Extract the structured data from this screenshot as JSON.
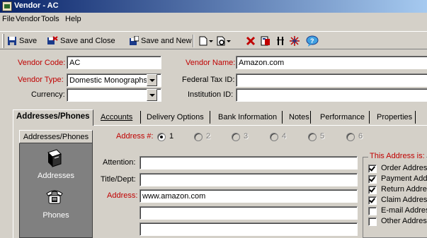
{
  "window": {
    "title": "Vendor - AC"
  },
  "menu": [
    "File",
    "Vendor",
    "Tools",
    "Help"
  ],
  "toolbar": {
    "save": "Save",
    "save_close": "Save and Close",
    "save_new": "Save and New"
  },
  "header": {
    "vendor_code_label": "Vendor Code:",
    "vendor_code_value": "AC",
    "vendor_name_label": "Vendor Name:",
    "vendor_name_value": "Amazon.com",
    "vendor_type_label": "Vendor Type:",
    "vendor_type_value": "Domestic Monographs",
    "federal_tax_label": "Federal Tax ID:",
    "federal_tax_value": "",
    "currency_label": "Currency:",
    "currency_value": "",
    "institution_label": "Institution ID:",
    "institution_value": ""
  },
  "tabs": [
    "Addresses/Phones",
    "Accounts",
    "Delivery Options",
    "Bank Information",
    "Notes",
    "Performance",
    "Properties"
  ],
  "leftnav": {
    "header": "Addresses/Phones",
    "items": [
      "Addresses",
      "Phones"
    ]
  },
  "address": {
    "number_label": "Address #:",
    "options": [
      "1",
      "2",
      "3",
      "4",
      "5",
      "6"
    ],
    "selected": "1",
    "attention_label": "Attention:",
    "attention_value": "",
    "title_label": "Title/Dept:",
    "title_value": "",
    "address_label": "Address:",
    "address_lines": [
      "www.amazon.com",
      "",
      ""
    ]
  },
  "this_address": {
    "label": "This Address is:",
    "items": [
      {
        "label": "Order Address",
        "checked": true
      },
      {
        "label": "Payment Address",
        "checked": true
      },
      {
        "label": "Return Address",
        "checked": true
      },
      {
        "label": "Claim Address",
        "checked": true
      },
      {
        "label": "E-mail Address",
        "checked": false
      },
      {
        "label": "Other Address",
        "checked": false
      }
    ]
  },
  "colors": {
    "required_label": "#c00000",
    "titlebar": "#0a246a",
    "nav_bg": "#808080"
  }
}
